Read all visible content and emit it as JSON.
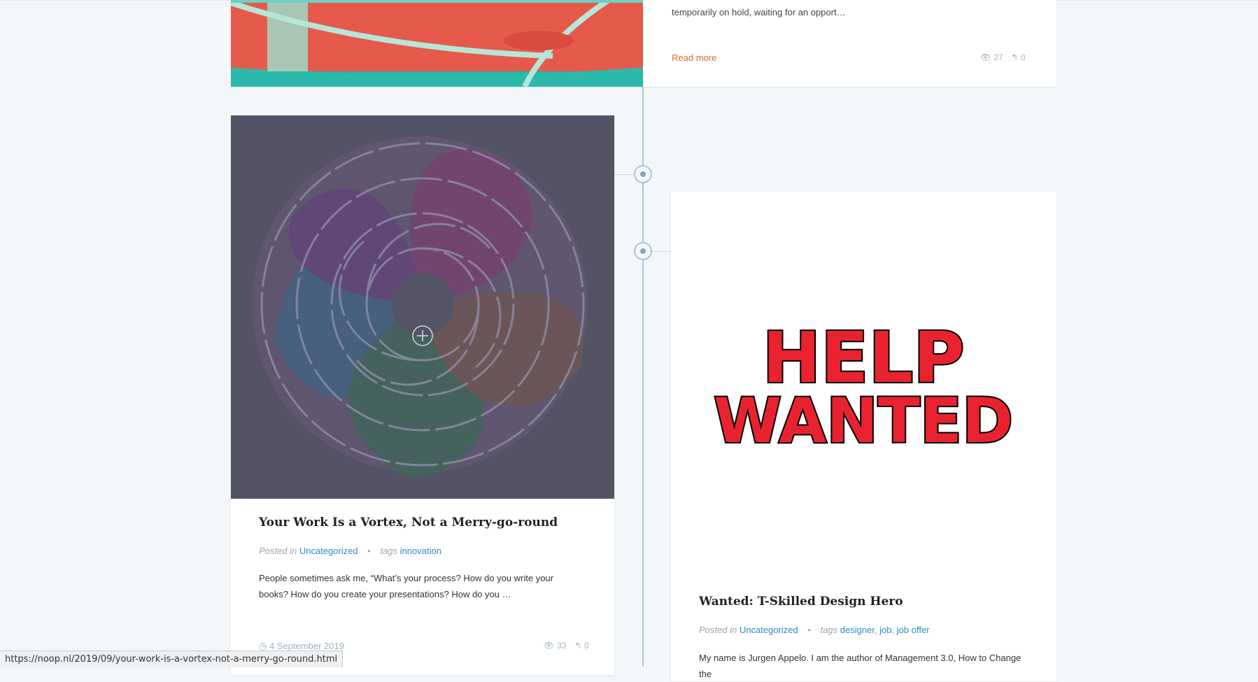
{
  "top_post": {
    "excerpt_line1": "temporarily on hold, waiting for an opport…",
    "read_more": "Read more",
    "views": "27",
    "comments": "0"
  },
  "vortex_post": {
    "title": "Your Work Is a Vortex, Not a Merry-go-round",
    "posted_in_label": "Posted in",
    "category": "Uncategorized",
    "tags_label": "tags",
    "tags": [
      "innovation"
    ],
    "excerpt": "People sometimes ask me, “What’s your process? How do you write your books? How do you create your presentations? How do you …",
    "date": "4 September 2019",
    "views": "33",
    "comments": "0"
  },
  "help_post": {
    "image_text_line1": "HELP",
    "image_text_line2": "WANTED",
    "title": "Wanted: T-Skilled Design Hero",
    "posted_in_label": "Posted in",
    "category": "Uncategorized",
    "tags_label": "tags",
    "tags": [
      "designer",
      "job",
      "job offer"
    ],
    "excerpt": "My name is Jurgen Appelo. I am the author of Management 3.0, How to Change the"
  },
  "status_url": "https://noop.nl/2019/09/your-work-is-a-vortex-not-a-merry-go-round.html",
  "colors": {
    "accent_link": "#2a8fc7",
    "read_more": "#e06b2e",
    "timeline": "#a9c7d8",
    "help_red": "#e8232f"
  },
  "icons": [
    "eye-icon",
    "reply-icon",
    "clock-icon",
    "zoom-plus-icon"
  ]
}
